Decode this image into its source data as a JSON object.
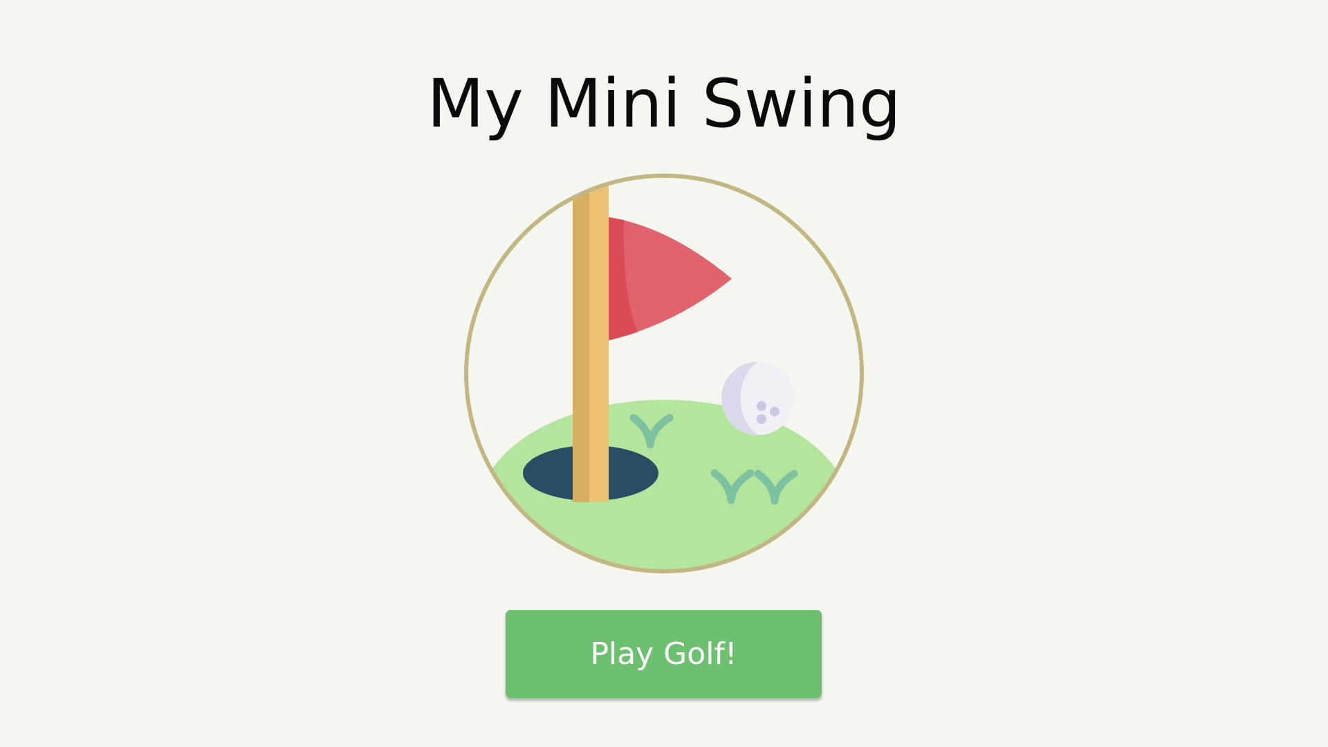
{
  "title": "My Mini Swing",
  "play_button": {
    "label": "Play Golf!"
  },
  "logo": {
    "icon": "golf-flag-hole-icon",
    "colors": {
      "ring": "#c3b683",
      "grass": "#b4e59c",
      "hole": "#294d63",
      "pole_light": "#ecc271",
      "pole_dark": "#d8ae62",
      "flag": "#e1636e",
      "flag_shadow": "#d84b57",
      "ball": "#f1f0f6",
      "ball_shadow": "#ddd9ec",
      "dimples": "#ccc6e4",
      "grass_tufts": "#7dc2a0"
    }
  },
  "colors": {
    "background": "#f5f6f0",
    "button": "#6cc070",
    "button_text": "#ffffff",
    "title_text": "#0a0a0a"
  }
}
